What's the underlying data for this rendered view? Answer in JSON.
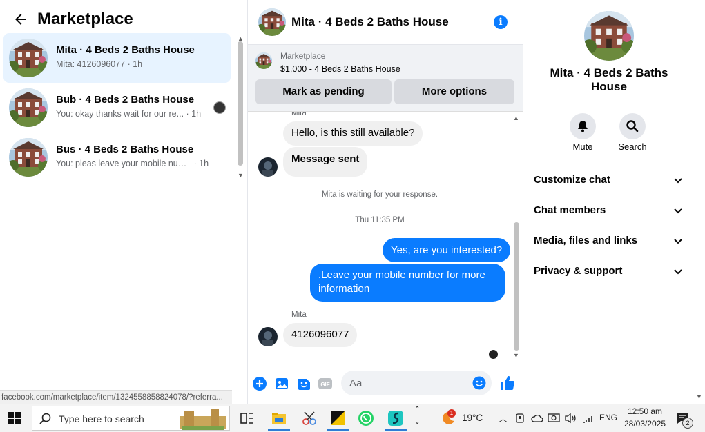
{
  "left": {
    "title": "Marketplace",
    "conversations": [
      {
        "name": "Mita · 4 Beds 2 Baths House",
        "preview": "Mita: 4126096077",
        "time": "· 1h"
      },
      {
        "name": "Bub · 4 Beds 2 Baths House",
        "preview": "You: okay thanks wait for our re...",
        "time": "· 1h"
      },
      {
        "name": "Bus · 4 Beds 2 Baths House",
        "preview": "You: pleas leave your mobile num...",
        "time": "· 1h"
      }
    ],
    "status_url": "facebook.com/marketplace/item/1324558858824078/?referra..."
  },
  "chat": {
    "header_name": "Mita · 4 Beds 2 Baths House",
    "listing_label": "Marketplace",
    "listing_price": "$1,000 - 4 Beds 2 Baths House",
    "btn_pending": "Mark as pending",
    "btn_more": "More options",
    "top_sender": "Mita",
    "msg1": "Hello, is this still available?",
    "msg2": "Message sent",
    "waiting": "Mita is waiting for your response.",
    "timestamp": "Thu 11:35 PM",
    "out1": "Yes, are you interested?",
    "out2": ".Leave your mobile number for more information",
    "sender2": "Mita",
    "msg3": "4126096077",
    "input_placeholder": "Aa"
  },
  "right": {
    "name": "Mita · 4 Beds 2 Baths House",
    "mute": "Mute",
    "search": "Search",
    "items": [
      "Customize chat",
      "Chat members",
      "Media, files and links",
      "Privacy & support"
    ]
  },
  "taskbar": {
    "search_placeholder": "Type here to search",
    "temp": "19°C",
    "lang": "ENG",
    "time": "12:50 am",
    "date": "28/03/2025",
    "notif_count": "2",
    "weather_badge": "1"
  },
  "colors": {
    "accent": "#0a7cff",
    "active_bg": "#e7f3ff"
  }
}
